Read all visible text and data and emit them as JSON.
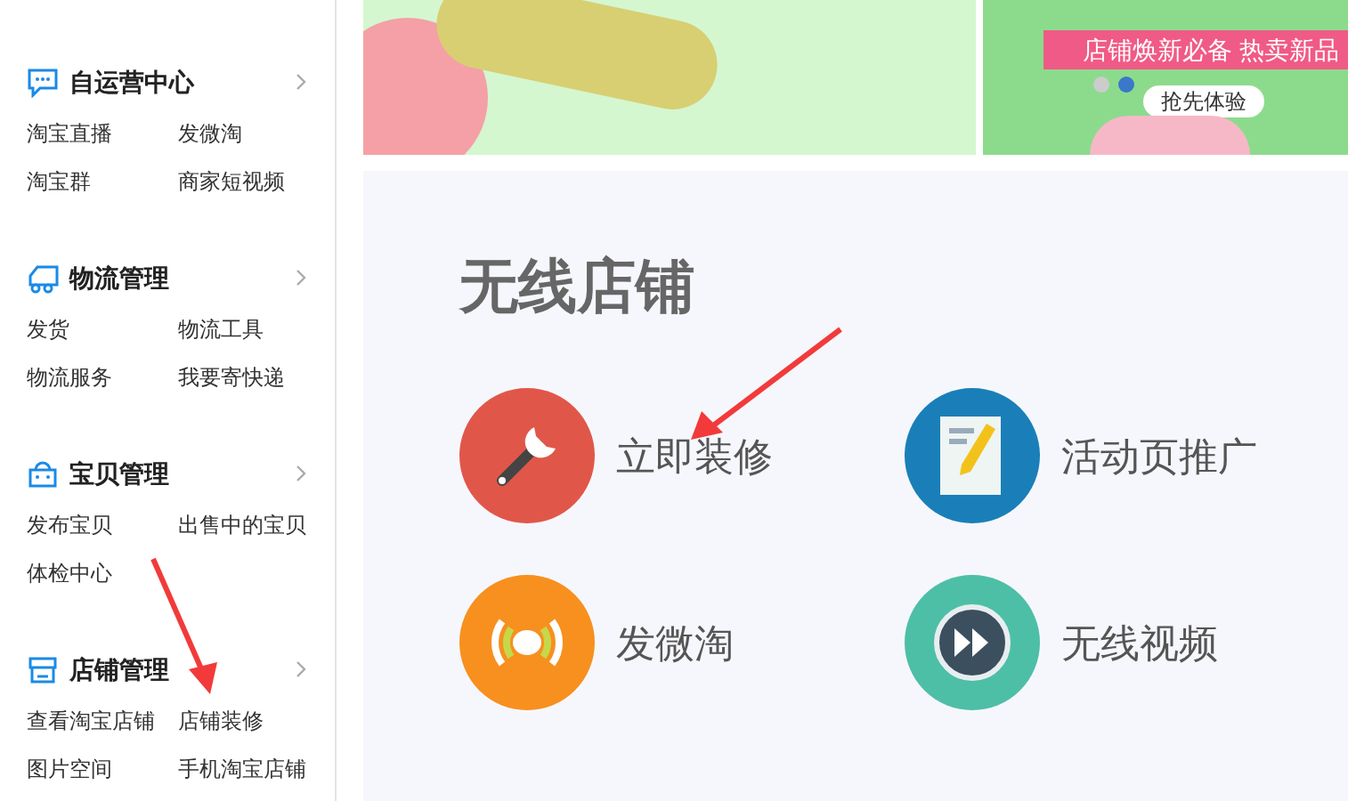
{
  "sidebar": {
    "sections": [
      {
        "kind": "chat",
        "title": "自运营中心",
        "links": [
          "淘宝直播",
          "发微淘",
          "淘宝群",
          "商家短视频"
        ]
      },
      {
        "kind": "truck",
        "title": "物流管理",
        "links": [
          "发货",
          "物流工具",
          "物流服务",
          "我要寄快递"
        ]
      },
      {
        "kind": "bag",
        "title": "宝贝管理",
        "links": [
          "发布宝贝",
          "出售中的宝贝",
          "体检中心"
        ]
      },
      {
        "kind": "store",
        "title": "店铺管理",
        "links": [
          "查看淘宝店铺",
          "店铺装修",
          "图片空间",
          "手机淘宝店铺"
        ]
      }
    ]
  },
  "banner": {
    "ribbon": "店铺焕新必备 热卖新品",
    "button": "抢先体验",
    "dots": [
      {
        "selected": false
      },
      {
        "selected": true
      }
    ]
  },
  "panel": {
    "title": "无线店铺",
    "items": [
      {
        "kind": "wrench",
        "label": "立即装修"
      },
      {
        "kind": "note",
        "label": "活动页推广"
      },
      {
        "kind": "signal",
        "label": "发微淘"
      },
      {
        "kind": "video",
        "label": "无线视频"
      }
    ]
  }
}
